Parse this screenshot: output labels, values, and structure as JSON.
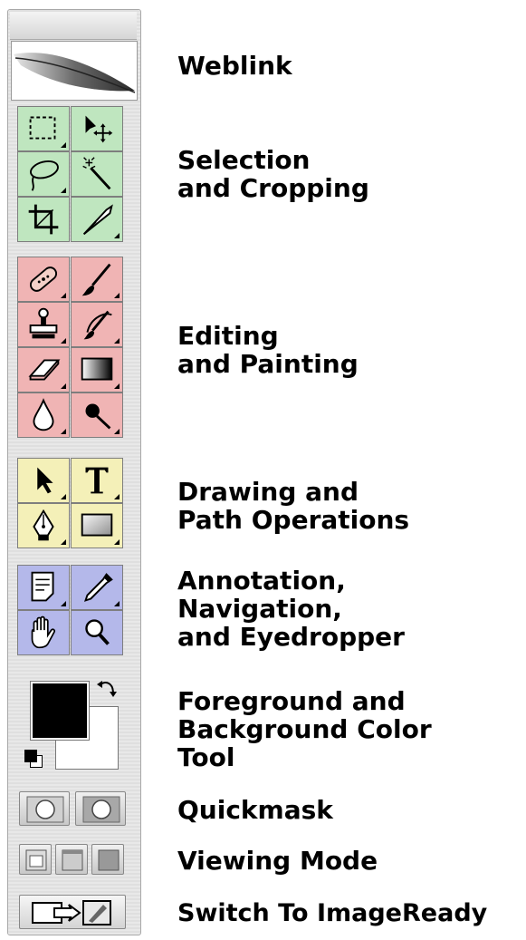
{
  "labels": {
    "weblink": "Weblink",
    "selection": [
      "Selection",
      "and Cropping"
    ],
    "editing": [
      "Editing",
      "and Painting"
    ],
    "drawing": [
      "Drawing and",
      "Path Operations"
    ],
    "annotation": [
      "Annotation,",
      "Navigation,",
      "and Eyedropper"
    ],
    "color": [
      "Foreground and",
      "Background Color",
      "Tool"
    ],
    "quickmask": "Quickmask",
    "viewing": "Viewing Mode",
    "switch": "Switch To ImageReady"
  },
  "tool_groups": {
    "selection": [
      "rectangular-marquee",
      "move",
      "lasso",
      "magic-wand",
      "crop",
      "slice"
    ],
    "editing": [
      "healing-brush",
      "brush",
      "clone-stamp",
      "history-brush",
      "eraser",
      "gradient",
      "blur",
      "dodge"
    ],
    "drawing": [
      "path-selection",
      "type",
      "pen",
      "rectangle-shape"
    ],
    "annotation": [
      "notes",
      "eyedropper",
      "hand",
      "zoom"
    ]
  },
  "colors": {
    "selection_bg": "#bfe6bf",
    "editing_bg": "#f0b4b4",
    "drawing_bg": "#f4f0b8",
    "annotation_bg": "#b4b8ea",
    "foreground": "#000000",
    "background": "#ffffff"
  }
}
